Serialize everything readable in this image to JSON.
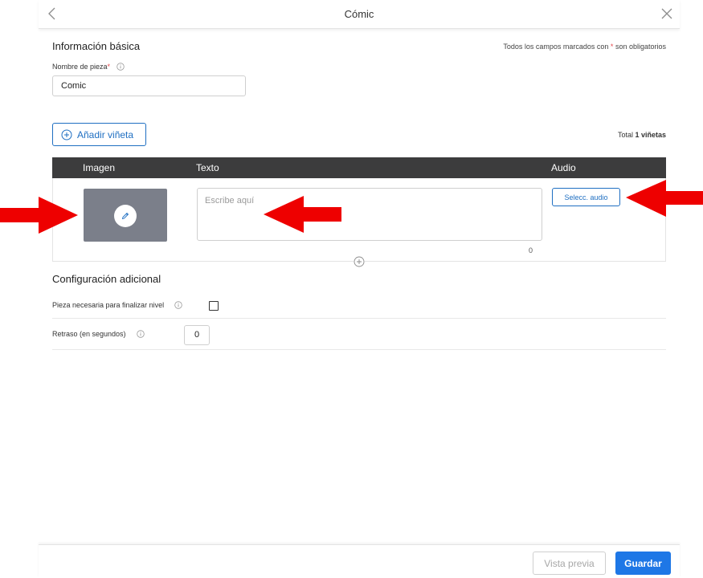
{
  "header": {
    "title": "Cómic",
    "back_icon": "chevron-left-icon",
    "close_icon": "close-icon"
  },
  "basic_info": {
    "title": "Información básica",
    "required_note_prefix": "Todos los campos marcados con",
    "required_star": "*",
    "required_note_suffix": "son obligatorios",
    "name_field": {
      "label": "Nombre de pieza",
      "required_mark": "*",
      "value": "Comic"
    }
  },
  "panels": {
    "add_button_label": "Añadir viñeta",
    "total_prefix": "Total",
    "total_count_label": "1 viñetas",
    "columns": {
      "image": "Imagen",
      "text": "Texto",
      "audio": "Audio"
    },
    "row": {
      "text_placeholder": "Escribe aquí",
      "char_count": "0",
      "audio_button": "Selecc. audio"
    }
  },
  "additional_config": {
    "title": "Configuración adicional",
    "required_to_finish_label": "Pieza necesaria para finalizar nivel",
    "required_to_finish_checked": false,
    "delay_label": "Retraso (en segundos)",
    "delay_value": "0"
  },
  "footer": {
    "preview_label": "Vista previa",
    "save_label": "Guardar"
  },
  "colors": {
    "accent": "#1e77e6",
    "header_dark": "#3c3c3d",
    "image_placeholder": "#7b7f8a",
    "annotation_arrow": "#ee0000"
  }
}
